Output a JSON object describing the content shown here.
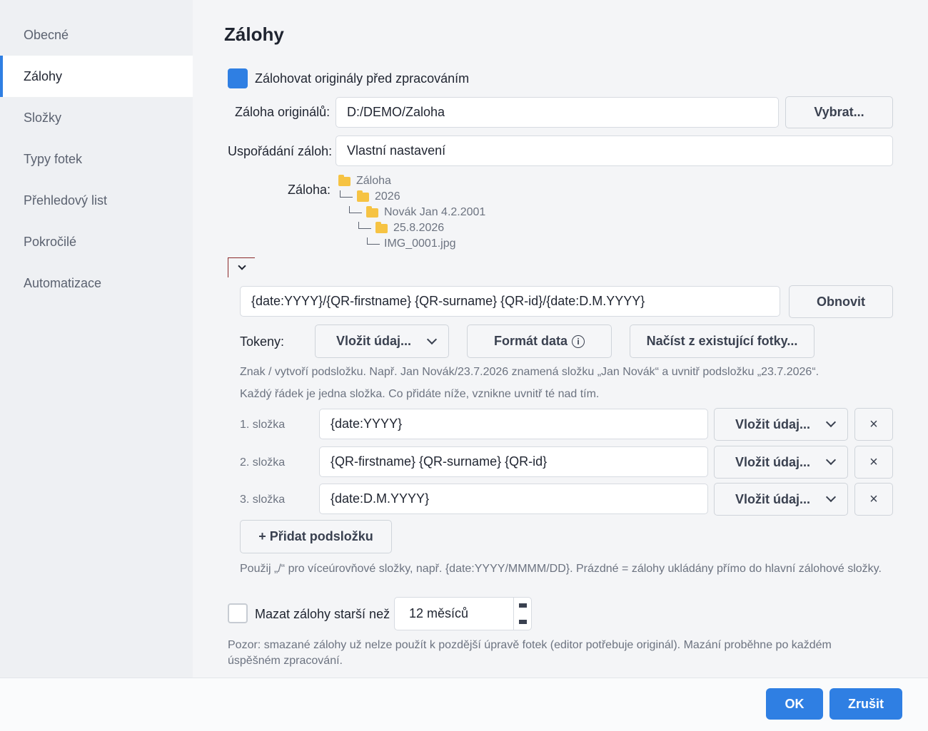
{
  "sidebar": {
    "items": [
      {
        "label": "Obecné"
      },
      {
        "label": "Zálohy"
      },
      {
        "label": "Složky"
      },
      {
        "label": "Typy fotek"
      },
      {
        "label": "Přehledový list"
      },
      {
        "label": "Pokročilé"
      },
      {
        "label": "Automatizace"
      }
    ],
    "active_index": 1
  },
  "main": {
    "title": "Zálohy",
    "backup_originals": {
      "label": "Zálohovat originály před zpracováním",
      "checked": true
    },
    "backup_path": {
      "label": "Záloha originálů:",
      "value": "D:/DEMO/Zaloha",
      "browse_label": "Vybrat..."
    },
    "organization": {
      "label": "Uspořádání záloh:",
      "value": "Vlastní nastavení"
    },
    "preview": {
      "label": "Záloha:",
      "tree": [
        "Záloha",
        "2026",
        "Novák Jan 4.2.2001",
        "25.8.2026",
        "IMG_0001.jpg"
      ]
    },
    "pattern": {
      "value": "{date:YYYY}/{QR-firstname} {QR-surname} {QR-id}/{date:D.M.YYYY}",
      "refresh_label": "Obnovit"
    },
    "tokens": {
      "label": "Tokeny:",
      "insert_label": "Vložit údaj...",
      "date_format_label": "Formát data",
      "load_label": "Načíst z existující fotky..."
    },
    "help1": "Znak / vytvoří podsložku. Např. Jan Novák/23.7.2026 znamená složku „Jan Novák“ a uvnitř podsložku „23.7.2026“.",
    "help2": "Každý řádek je jedna složka. Co přidáte níže, vznikne uvnitř té nad tím.",
    "folders": [
      {
        "label": "1. složka",
        "value": "{date:YYYY}",
        "insert_label": "Vložit údaj...",
        "remove": "×"
      },
      {
        "label": "2. složka",
        "value": "{QR-firstname} {QR-surname} {QR-id}",
        "insert_label": "Vložit údaj...",
        "remove": "×"
      },
      {
        "label": "3. složka",
        "value": "{date:D.M.YYYY}",
        "insert_label": "Vložit údaj...",
        "remove": "×"
      }
    ],
    "add_subfolder_label": "+ Přidat podsložku",
    "help3": "Použij „/“ pro víceúrovňové složky, např. {date:YYYY/MMMM/DD}. Prázdné = zálohy ukládány přímo do hlavní zálohové složky.",
    "delete_old": {
      "label": "Mazat zálohy starší než",
      "checked": false,
      "value": "12 měsíců"
    },
    "warning": "Pozor: smazané zálohy už nelze použít k pozdější úpravě fotek (editor potřebuje originál). Mazání proběhne po každém úspěšném zpracování."
  },
  "footer": {
    "ok_label": "OK",
    "cancel_label": "Zrušit"
  },
  "colors": {
    "accent": "#2f7fe3",
    "sidebar_bg": "#eef0f3",
    "page_bg": "#f4f5f7"
  }
}
